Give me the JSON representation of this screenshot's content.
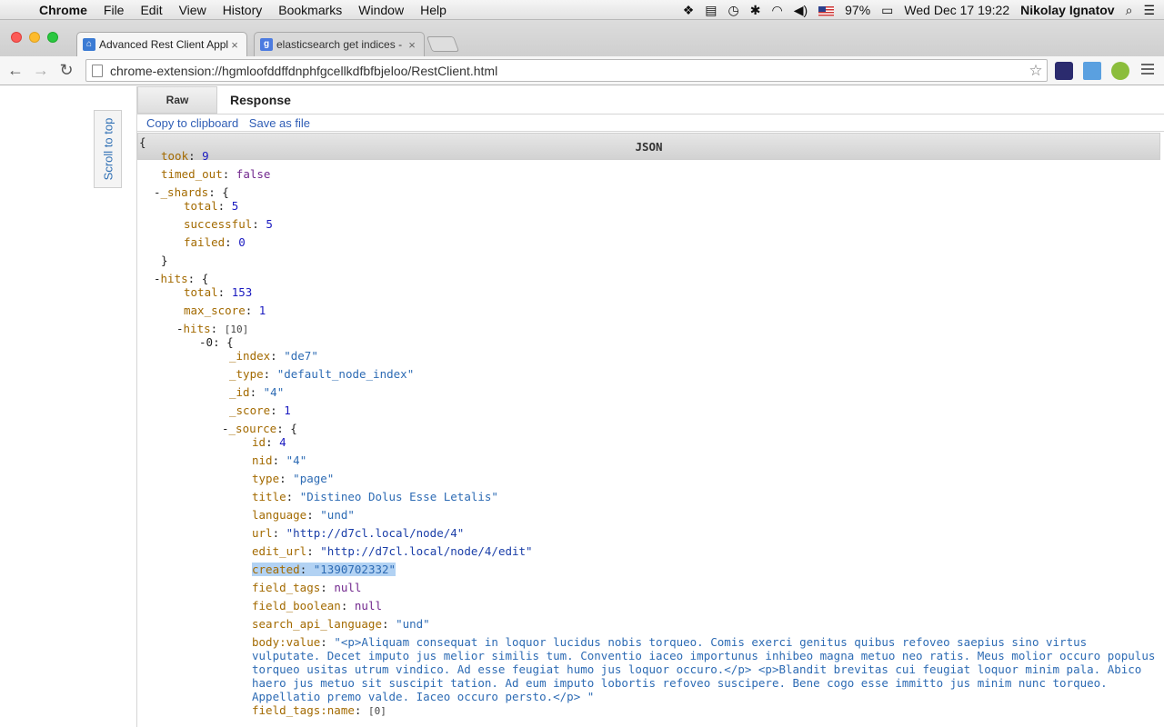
{
  "menubar": {
    "apple": "",
    "items": [
      "Chrome",
      "File",
      "Edit",
      "View",
      "History",
      "Bookmarks",
      "Window",
      "Help"
    ],
    "battery": "97%",
    "datetime": "Wed Dec 17  19:22",
    "user": "Nikolay Ignatov"
  },
  "tabs": [
    {
      "title": "Advanced Rest Client Appl",
      "favicon_color": "#3b7bd4"
    },
    {
      "title": "elasticsearch get indices -",
      "favicon_color": "#4c7be0"
    }
  ],
  "toolbar": {
    "url": "chrome-extension://hgmloofddffdnphfgcellkdfbfbjeloo/RestClient.html"
  },
  "sidebar": {
    "scroll_to_top": "Scroll to top"
  },
  "response": {
    "tab_raw": "Raw",
    "tab_json": "JSON",
    "label": "Response",
    "copy": "Copy to clipboard",
    "save": "Save as file"
  },
  "json": {
    "open": "{",
    "took_key": "took",
    "took_val": "9",
    "timed_out_key": "timed_out",
    "timed_out_val": "false",
    "shards_key": "_shards",
    "shards_total_key": "total",
    "shards_total_val": "5",
    "shards_successful_key": "successful",
    "shards_successful_val": "5",
    "shards_failed_key": "failed",
    "shards_failed_val": "0",
    "close_brace": "}",
    "hits_key": "hits",
    "hits_total_key": "total",
    "hits_total_val": "153",
    "max_score_key": "max_score",
    "max_score_val": "1",
    "hits_arr_key": "hits",
    "hits_count": "[10]",
    "item0_key": "0",
    "index_key": "_index",
    "index_val": "\"de7\"",
    "type_key": "_type",
    "type_val": "\"default_node_index\"",
    "id_key": "_id",
    "id_val": "\"4\"",
    "score_key": "_score",
    "score_val": "1",
    "source_key": "_source",
    "src_id_key": "id",
    "src_id_val": "4",
    "nid_key": "nid",
    "nid_val": "\"4\"",
    "src_type_key": "type",
    "src_type_val": "\"page\"",
    "title_key": "title",
    "title_val": "\"Distineo Dolus Esse Letalis\"",
    "language_key": "language",
    "language_val": "\"und\"",
    "url_key": "url",
    "url_val": "\"http://d7cl.local/node/4\"",
    "edit_url_key": "edit_url",
    "edit_url_val": "\"http://d7cl.local/node/4/edit\"",
    "created_key": "created",
    "created_val": "\"1390702332\"",
    "field_tags_key": "field_tags",
    "field_tags_val": "null",
    "field_boolean_key": "field_boolean",
    "field_boolean_val": "null",
    "search_api_language_key": "search_api_language",
    "search_api_language_val": "\"und\"",
    "body_key": "body:value",
    "body_val": "\"<p>Aliquam consequat in loquor lucidus nobis torqueo. Comis exerci genitus quibus refoveo saepius sino virtus vulputate. Decet imputo jus melior similis tum. Conventio iaceo importunus inhibeo magna metuo neo ratis. Meus molior occuro populus torqueo usitas utrum vindico. Ad esse feugiat humo jus loquor occuro.</p> <p>Blandit brevitas cui feugiat loquor minim pala. Abico haero jus metuo sit suscipit tation. Ad eum imputo lobortis refoveo suscipere. Bene cogo esse immitto jus minim nunc torqueo. Appellatio premo valde. Iaceo occuro persto.</p> \"",
    "field_tags_name_key": "field_tags:name",
    "field_tags_name_val": "[0]"
  }
}
